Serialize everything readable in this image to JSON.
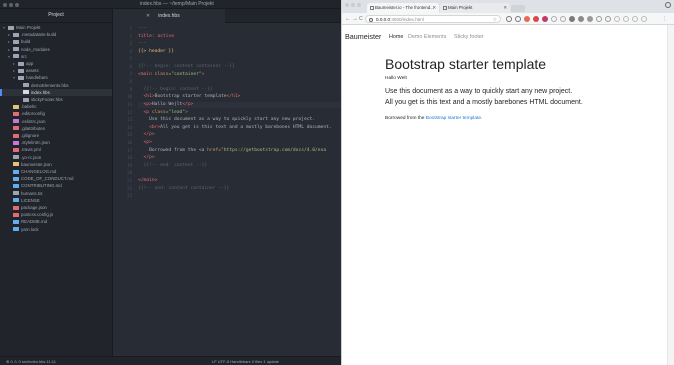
{
  "editor": {
    "title": "index.hbs — ~/temp/Main Projekt",
    "tree_header": "Project",
    "tree": [
      {
        "label": "Main Projekt",
        "depth": 0,
        "caret": "▾",
        "icon": "folder-icon",
        "color": "#9da5b4"
      },
      {
        "label": ".metadatatm-build",
        "depth": 1,
        "caret": "▸",
        "icon": "folder-icon",
        "color": "#9da5b4"
      },
      {
        "label": "build",
        "depth": 1,
        "caret": "▸",
        "icon": "folder-icon",
        "color": "#9da5b4"
      },
      {
        "label": "node_modules",
        "depth": 1,
        "caret": "▸",
        "icon": "folder-icon",
        "color": "#9da5b4"
      },
      {
        "label": "src",
        "depth": 1,
        "caret": "▾",
        "icon": "folder-icon",
        "color": "#9da5b4"
      },
      {
        "label": "app",
        "depth": 2,
        "caret": "▸",
        "icon": "folder-icon",
        "color": "#9da5b4"
      },
      {
        "label": "assets",
        "depth": 2,
        "caret": "▸",
        "icon": "folder-icon",
        "color": "#9da5b4"
      },
      {
        "label": "handlebars",
        "depth": 2,
        "caret": "▾",
        "icon": "folder-icon",
        "color": "#9da5b4"
      },
      {
        "label": "demoElements.hbs",
        "depth": 3,
        "caret": "",
        "icon": "file-icon",
        "color": "#9da5b4"
      },
      {
        "label": "index.hbs",
        "depth": 3,
        "caret": "",
        "icon": "file-icon",
        "color": "#d7dae0",
        "selected": true
      },
      {
        "label": "stickyFooter.hbs",
        "depth": 3,
        "caret": "",
        "icon": "file-icon",
        "color": "#9da5b4"
      },
      {
        "label": ".babelrc",
        "depth": 1,
        "caret": "",
        "icon": "config-file-icon",
        "color": "#e5c07b"
      },
      {
        "label": ".editorconfig",
        "depth": 1,
        "caret": "",
        "icon": "config-file-icon",
        "color": "#e06c75"
      },
      {
        "label": ".eslintrc.json",
        "depth": 1,
        "caret": "",
        "icon": "config-file-icon",
        "color": "#c678dd"
      },
      {
        "label": ".gitattributes",
        "depth": 1,
        "caret": "",
        "icon": "git-file-icon",
        "color": "#e06c75"
      },
      {
        "label": ".gitignore",
        "depth": 1,
        "caret": "",
        "icon": "git-file-icon",
        "color": "#e06c75"
      },
      {
        "label": ".stylelintrc.json",
        "depth": 1,
        "caret": "",
        "icon": "config-file-icon",
        "color": "#c678dd"
      },
      {
        "label": ".travis.yml",
        "depth": 1,
        "caret": "",
        "icon": "config-file-icon",
        "color": "#e06c75"
      },
      {
        "label": ".yo-rc.json",
        "depth": 1,
        "caret": "",
        "icon": "config-file-icon",
        "color": "#9da5b4"
      },
      {
        "label": "baumeister.json",
        "depth": 1,
        "caret": "",
        "icon": "json-file-icon",
        "color": "#e5c07b"
      },
      {
        "label": "CHANGELOG.md",
        "depth": 1,
        "caret": "",
        "icon": "markdown-file-icon",
        "color": "#61afef"
      },
      {
        "label": "CODE_OF_CONDUCT.md",
        "depth": 1,
        "caret": "",
        "icon": "markdown-file-icon",
        "color": "#61afef"
      },
      {
        "label": "CONTRIBUTING.md",
        "depth": 1,
        "caret": "",
        "icon": "markdown-file-icon",
        "color": "#61afef"
      },
      {
        "label": "humans.txt",
        "depth": 1,
        "caret": "",
        "icon": "text-file-icon",
        "color": "#9da5b4"
      },
      {
        "label": "LICENSE",
        "depth": 1,
        "caret": "",
        "icon": "license-file-icon",
        "color": "#61afef"
      },
      {
        "label": "package.json",
        "depth": 1,
        "caret": "",
        "icon": "npm-file-icon",
        "color": "#e06c75"
      },
      {
        "label": "postcss.config.js",
        "depth": 1,
        "caret": "",
        "icon": "js-file-icon",
        "color": "#e06c75"
      },
      {
        "label": "README.md",
        "depth": 1,
        "caret": "",
        "icon": "markdown-file-icon",
        "color": "#61afef"
      },
      {
        "label": "yarn.lock",
        "depth": 1,
        "caret": "",
        "icon": "lock-file-icon",
        "color": "#61afef"
      }
    ],
    "tab": {
      "label": "index.hbs",
      "close": "✕"
    },
    "code_lines": [
      {
        "n": "1",
        "segs": [
          {
            "t": "---",
            "c": "#7f848e"
          }
        ]
      },
      {
        "n": "2",
        "segs": [
          {
            "t": "title: active",
            "c": "#e06c75"
          }
        ]
      },
      {
        "n": "3",
        "segs": [
          {
            "t": "---",
            "c": "#7f848e"
          }
        ]
      },
      {
        "n": "4",
        "segs": [
          {
            "t": "{{> header }}",
            "c": "#e5c07b"
          }
        ]
      },
      {
        "n": "5",
        "segs": [
          {
            "t": "",
            "c": "#abb2bf"
          }
        ]
      },
      {
        "n": "6",
        "segs": [
          {
            "t": "{{!-- begin: content container --}}",
            "c": "#5c6370"
          }
        ]
      },
      {
        "n": "7",
        "segs": [
          {
            "t": "<main ",
            "c": "#e06c75"
          },
          {
            "t": "class=",
            "c": "#d19a66"
          },
          {
            "t": "\"container\"",
            "c": "#98c379"
          },
          {
            "t": ">",
            "c": "#e06c75"
          }
        ]
      },
      {
        "n": "8",
        "segs": [
          {
            "t": "",
            "c": "#abb2bf"
          }
        ]
      },
      {
        "n": "9",
        "segs": [
          {
            "t": "  {{!-- begin: content --}}",
            "c": "#5c6370"
          }
        ]
      },
      {
        "n": "10",
        "segs": [
          {
            "t": "  <h1>",
            "c": "#e06c75"
          },
          {
            "t": "Bootstrap starter template",
            "c": "#abb2bf"
          },
          {
            "t": "</h1>",
            "c": "#e06c75"
          }
        ]
      },
      {
        "n": "11",
        "segs": [
          {
            "t": "  <p>",
            "c": "#e06c75"
          },
          {
            "t": "Hallo We|lt",
            "c": "#abb2bf"
          },
          {
            "t": "</p>",
            "c": "#e06c75"
          }
        ],
        "cursor": true
      },
      {
        "n": "12",
        "segs": [
          {
            "t": "  <p ",
            "c": "#e06c75"
          },
          {
            "t": "class=",
            "c": "#d19a66"
          },
          {
            "t": "\"lead\"",
            "c": "#98c379"
          },
          {
            "t": ">",
            "c": "#e06c75"
          }
        ]
      },
      {
        "n": "13",
        "segs": [
          {
            "t": "    Use this document as a way to quickly start any new project.",
            "c": "#abb2bf"
          }
        ]
      },
      {
        "n": "14",
        "segs": [
          {
            "t": "    <br>",
            "c": "#e06c75"
          },
          {
            "t": "All you get is this text and a mostly barebones HTML document.",
            "c": "#abb2bf"
          }
        ]
      },
      {
        "n": "15",
        "segs": [
          {
            "t": "  </p>",
            "c": "#e06c75"
          }
        ]
      },
      {
        "n": "16",
        "segs": [
          {
            "t": "  <p>",
            "c": "#e06c75"
          }
        ]
      },
      {
        "n": "17",
        "segs": [
          {
            "t": "    Borrowed from the <a ",
            "c": "#abb2bf"
          },
          {
            "t": "href=",
            "c": "#d19a66"
          },
          {
            "t": "\"https://getbootstrap.com/docs/4.0/exa",
            "c": "#98c379"
          }
        ]
      },
      {
        "n": "18",
        "segs": [
          {
            "t": "  </p>",
            "c": "#e06c75"
          }
        ]
      },
      {
        "n": "19",
        "segs": [
          {
            "t": "  {{!-- end: content --}}",
            "c": "#5c6370"
          }
        ]
      },
      {
        "n": "20",
        "segs": [
          {
            "t": "",
            "c": "#abb2bf"
          }
        ]
      },
      {
        "n": "21",
        "segs": [
          {
            "t": "</main>",
            "c": "#e06c75"
          }
        ]
      },
      {
        "n": "22",
        "segs": [
          {
            "t": "{{!-- end: content container --}}",
            "c": "#5c6370"
          }
        ]
      },
      {
        "n": "23",
        "segs": [
          {
            "t": "",
            "c": "#abb2bf"
          }
        ]
      }
    ],
    "status": {
      "left": "⊗ 0  ⚠ 0   src/index.hbs   11:11",
      "right": "LF   UTF-8   Handlebars   0 files   1 update"
    }
  },
  "browser": {
    "tabs": [
      {
        "label": "Baumeister.io - The frontend...",
        "close": "✕",
        "active": true
      },
      {
        "label": "Main Projekt",
        "close": "✕",
        "active": false
      }
    ],
    "address": {
      "host": "0.0.0.0",
      "path": ":3000/index.html"
    },
    "nav_icons": {
      "back": "←",
      "forward": "→",
      "reload": "C"
    },
    "navbar": {
      "brand": "Baumeister",
      "links": [
        {
          "label": "Home",
          "active": true
        },
        {
          "label": "Demo Elements",
          "active": false
        },
        {
          "label": "Sticky footer",
          "active": false
        }
      ]
    },
    "page": {
      "heading": "Bootstrap starter template",
      "subtext": "Hallo Welt",
      "lead1": "Use this document as a way to quickly start any new project.",
      "lead2": "All you get is this text and a mostly barebones HTML document.",
      "borrowed_prefix": "Borrowed from the ",
      "borrowed_link": "Bootstrap starter template",
      "borrowed_suffix": "."
    },
    "link_color": "#1a7bd6"
  }
}
